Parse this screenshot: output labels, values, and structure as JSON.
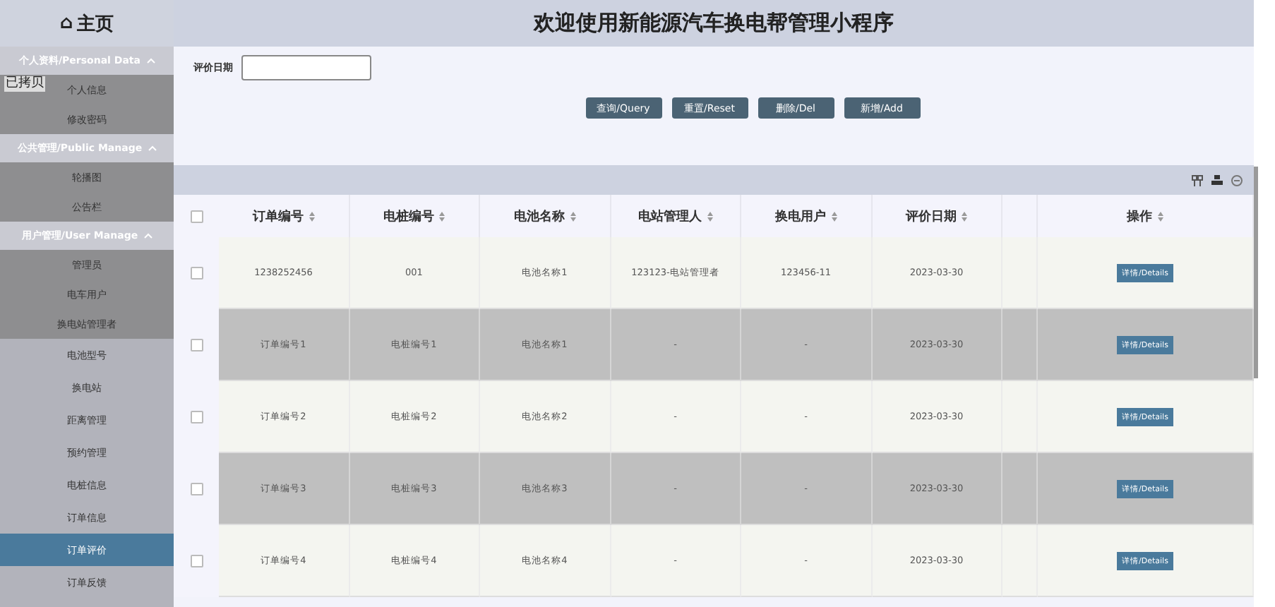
{
  "sidebar": {
    "home": {
      "icon": "⌂",
      "label": "主页"
    },
    "tooltip": "已拷贝",
    "groups": [
      {
        "title": "个人资料/Personal Data",
        "expanded": true,
        "items": [
          {
            "label": "个人信息",
            "selected": false
          },
          {
            "label": "修改密码",
            "selected": false
          }
        ]
      },
      {
        "title": "公共管理/Public Manage",
        "expanded": true,
        "items": [
          {
            "label": "轮播图",
            "selected": false
          },
          {
            "label": "公告栏",
            "selected": false
          }
        ]
      },
      {
        "title": "用户管理/User Manage",
        "expanded": true,
        "items": [
          {
            "label": "管理员",
            "selected": false
          },
          {
            "label": "电车用户",
            "selected": false
          },
          {
            "label": "换电站管理者",
            "selected": false
          }
        ]
      }
    ],
    "items": [
      {
        "label": "电池型号",
        "selected": false
      },
      {
        "label": "换电站",
        "selected": false
      },
      {
        "label": "距离管理",
        "selected": false
      },
      {
        "label": "预约管理",
        "selected": false
      },
      {
        "label": "电桩信息",
        "selected": false
      },
      {
        "label": "订单信息",
        "selected": false
      },
      {
        "label": "订单评价",
        "selected": true
      },
      {
        "label": "订单反馈",
        "selected": false
      }
    ]
  },
  "header": {
    "title": "欢迎使用新能源汽车换电帮管理小程序"
  },
  "search": {
    "label": "评价日期"
  },
  "buttons": [
    "查询/Query",
    "重置/Reset",
    "删除/Del",
    "新增/Add"
  ],
  "table": {
    "select_all_checked": false,
    "columns": [
      "订单编号",
      "电桩编号",
      "电池名称",
      "电站管理人",
      "换电用户",
      "评价日期",
      "操作"
    ],
    "rows": [
      {
        "checked": false,
        "cells": [
          "1238252456",
          "001",
          "电池名称1",
          "123123-电站管理者",
          "123456-11",
          "2023-03-30"
        ],
        "action": "详情/Details"
      },
      {
        "checked": false,
        "cells": [
          "订单编号1",
          "电桩编号1",
          "电池名称1",
          "-",
          "-",
          "2023-03-30"
        ],
        "action": "详情/Details"
      },
      {
        "checked": false,
        "cells": [
          "订单编号2",
          "电桩编号2",
          "电池名称2",
          "-",
          "-",
          "2023-03-30"
        ],
        "action": "详情/Details"
      },
      {
        "checked": false,
        "cells": [
          "订单编号3",
          "电桩编号3",
          "电池名称3",
          "-",
          "-",
          "2023-03-30"
        ],
        "action": "详情/Details"
      },
      {
        "checked": false,
        "cells": [
          "订单编号4",
          "电桩编号4",
          "电池名称4",
          "-",
          "-",
          "2023-03-30"
        ],
        "action": "详情/Details"
      }
    ]
  }
}
